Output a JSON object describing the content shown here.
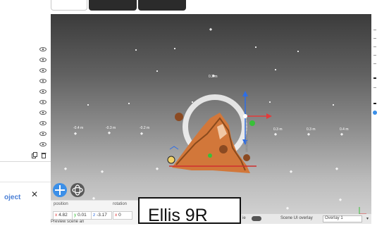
{
  "caption": "Ellis 9R",
  "project_panel": {
    "label": "oject",
    "close_glyph": "✕"
  },
  "transform": {
    "position_label": "position",
    "rotation_label": "rotation",
    "position": {
      "x_label": "x",
      "x": "4.82",
      "y_label": "y",
      "y": "0.01",
      "z_label": "z",
      "z": "-3.17"
    },
    "rotation": {
      "x_label": "x",
      "x": "0"
    }
  },
  "preview_label": "Preview scene an",
  "bottom_bar": {
    "toggle_label": "ie",
    "overlay_label": "Scene UI overlay",
    "overlay_select": "Overlay 1"
  },
  "grid_labels": [
    "-0.4 m",
    "-0.3 m",
    "-0.2 m",
    "0.3 m",
    "0.3 m",
    "0.4 m",
    "0.2 m"
  ],
  "icons": {
    "visibility": "eye-icon",
    "duplicate": "copy-icon",
    "delete": "trash-icon",
    "move_tool": "move-icon",
    "orbit_tool": "orbit-icon"
  },
  "colors": {
    "accent": "#3b8fe8",
    "model": "#d2773a",
    "gizmo_x": "#e33b3b",
    "gizmo_y": "#2e6ee6",
    "gizmo_z": "#38c038"
  }
}
